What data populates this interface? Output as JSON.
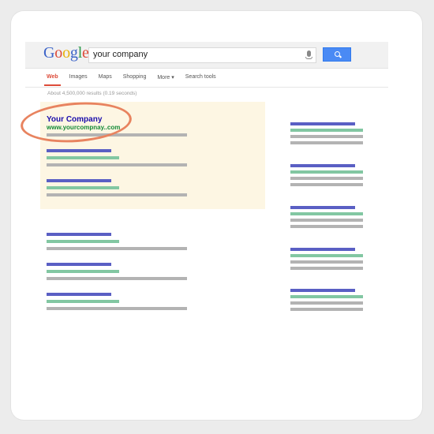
{
  "logo": {
    "letters": [
      {
        "char": "G",
        "color": "#3b63c8"
      },
      {
        "char": "o",
        "color": "#dd4b39"
      },
      {
        "char": "o",
        "color": "#e9b10a"
      },
      {
        "char": "g",
        "color": "#3b63c8"
      },
      {
        "char": "l",
        "color": "#2f9a4c"
      },
      {
        "char": "e",
        "color": "#dd4b39"
      }
    ]
  },
  "search": {
    "query": "your company"
  },
  "tabs": [
    {
      "label": "Web",
      "active": true
    },
    {
      "label": "Images",
      "active": false
    },
    {
      "label": "Maps",
      "active": false
    },
    {
      "label": "Shopping",
      "active": false
    },
    {
      "label": "More ▾",
      "active": false
    },
    {
      "label": "Search tools",
      "active": false
    }
  ],
  "stats": "About 4,500,000 results (0.19 seconds)",
  "featured_result": {
    "title": "Your Company",
    "url": "www.yourcompnay..com"
  },
  "colors": {
    "highlight": "#fdf6e3",
    "circle": "#e8835f",
    "title_bar": "#5a5fc4",
    "url_bar": "#82c7a2",
    "snippet_bar": "#b3b3b3"
  }
}
